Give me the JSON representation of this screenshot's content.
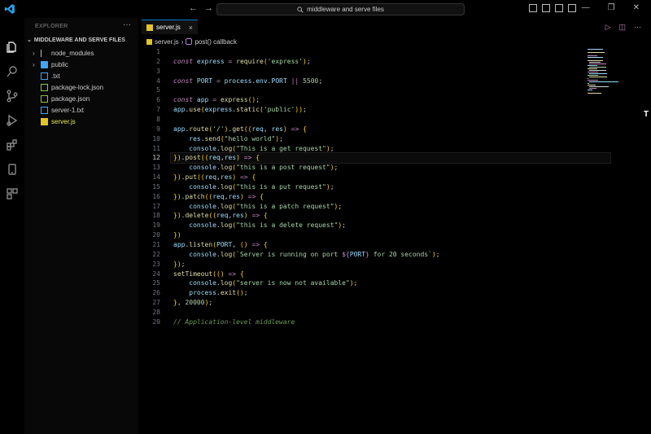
{
  "window": {
    "search_text": "middleware and serve files"
  },
  "sidebar": {
    "title": "EXPLORER",
    "more": "···",
    "section": "MIDDLEWARE AND SERVE FILES",
    "items": [
      {
        "label": "node_modules",
        "type": "folder"
      },
      {
        "label": "public",
        "type": "folder"
      },
      {
        "label": ".txt",
        "type": "file"
      },
      {
        "label": "package-lock.json",
        "type": "json"
      },
      {
        "label": "package.json",
        "type": "json"
      },
      {
        "label": "server-1.txt",
        "type": "file"
      },
      {
        "label": "server.js",
        "type": "js"
      }
    ]
  },
  "editor": {
    "tab_label": "server.js",
    "breadcrumb_file": "server.js",
    "breadcrumb_symbol": "post() callback",
    "current_line": 12,
    "lines": [
      "",
      "const express = require('express');",
      "",
      "const PORT = process.env.PORT || 5500;",
      "",
      "const app = express();",
      "app.use(express.static('public'));",
      "",
      "app.route('/').get((req, res) => {",
      "    res.send(\"hello world\");",
      "    console.log(\"This is a get request\");",
      "}).post((req,res) => {",
      "    console.log(\"this is a post request\");",
      "}).put((req,res) => {",
      "    console.log(\"this is a put request\");",
      "}).patch((req,res) => {",
      "    console.log(\"this is a patch request\");",
      "}).delete((req,res) => {",
      "    console.log(\"this is a delete request\");",
      "})",
      "app.listen(PORT, () => {",
      "    console.log(`Server is running on port ${PORT} for 20 seconds`);",
      "});",
      "setTimeout(() => {",
      "    console.log(\"server is now not available\");",
      "    process.exit();",
      "}, 20000);",
      "",
      "// Application-level middleware"
    ]
  },
  "edge_glyph": "T"
}
